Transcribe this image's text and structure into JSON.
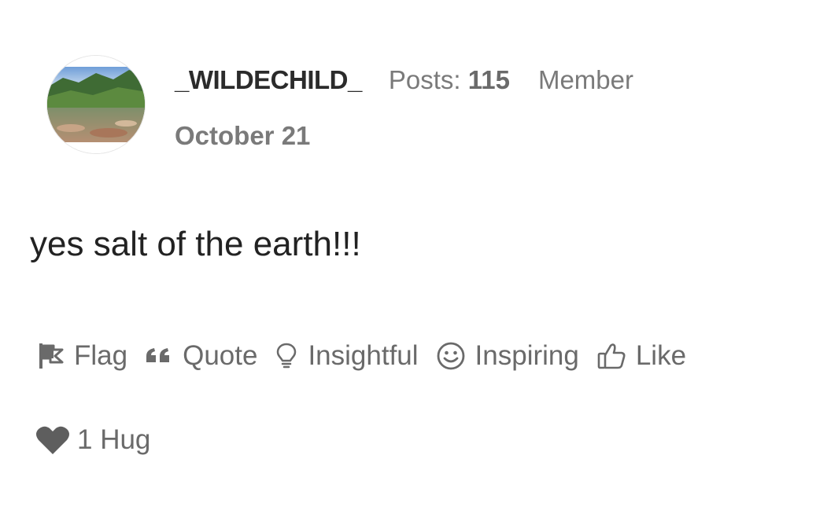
{
  "post": {
    "author": {
      "username": "_WILDECHILD_",
      "posts_label": "Posts:",
      "posts_count": "115",
      "role": "Member",
      "avatar_icon": "landscape-avatar"
    },
    "date": "October 21",
    "body": "yes salt of the earth!!!",
    "actions": [
      {
        "label": "Flag",
        "icon": "flag-icon"
      },
      {
        "label": "Quote",
        "icon": "quote-icon"
      },
      {
        "label": "Insightful",
        "icon": "lightbulb-icon"
      },
      {
        "label": "Inspiring",
        "icon": "smiley-icon"
      },
      {
        "label": "Like",
        "icon": "thumbs-up-icon"
      }
    ],
    "reactions": [
      {
        "label": "1 Hug",
        "icon": "heart-icon"
      }
    ]
  },
  "colors": {
    "text_primary": "#222222",
    "text_muted": "#7a7a7a",
    "icon": "#6a6a6a"
  }
}
